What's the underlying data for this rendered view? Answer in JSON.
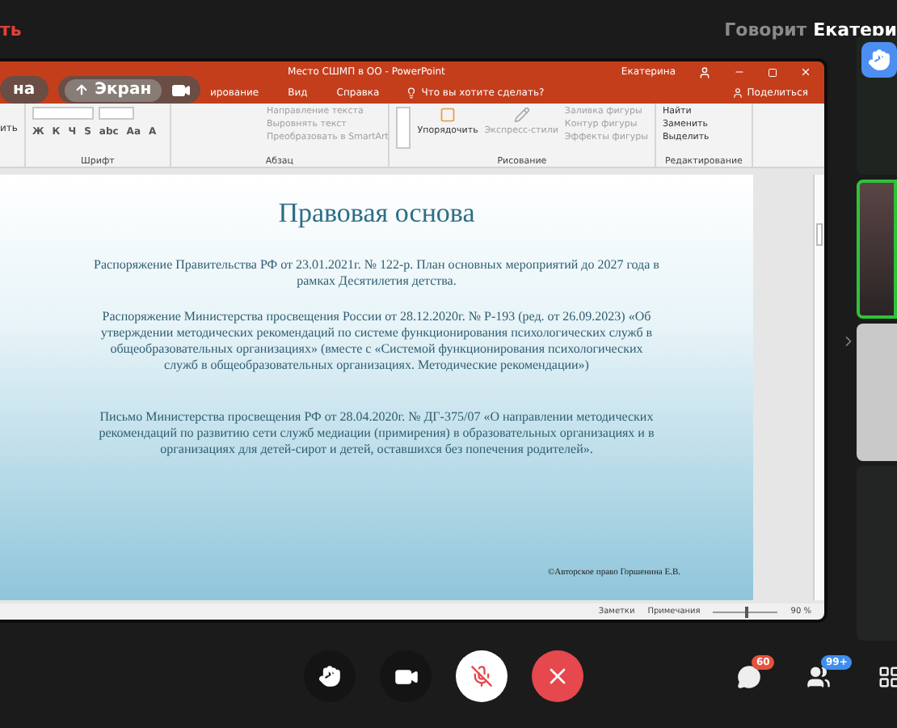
{
  "top_bar": {
    "left_text": "ть",
    "speaker_label": "Говорит",
    "speaker_name": "Екатери"
  },
  "overlay": {
    "window_button": "на",
    "screen_button": "Экран"
  },
  "powerpoint": {
    "title": "Место СШМП в ОО  -  PowerPoint",
    "user": "Екатерина",
    "left_cut": "ить",
    "tabs": [
      {
        "label": "ирование",
        "selected": false
      },
      {
        "label": "Вид",
        "selected": false
      },
      {
        "label": "Справка",
        "selected": false
      }
    ],
    "tell_me": "Что вы хотите сделать?",
    "share": "Поделиться",
    "font_keys": [
      "Ж",
      "К",
      "Ч",
      "S",
      "abc",
      "Aa",
      "A"
    ],
    "groups": [
      {
        "label": "Шрифт"
      },
      {
        "label": "Абзац",
        "commands": [
          {
            "text": "Направление текста",
            "disabled": true
          },
          {
            "text": "Выровнять текст",
            "disabled": true
          },
          {
            "text": "Преобразовать в SmartArt",
            "disabled": true
          }
        ]
      },
      {
        "label": "Рисование",
        "big_buttons": [
          {
            "text": "Упорядочить",
            "disabled": false
          },
          {
            "text": "Экспресс-стили",
            "disabled": true
          }
        ],
        "commands": [
          {
            "text": "Заливка фигуры",
            "disabled": true
          },
          {
            "text": "Контур фигуры",
            "disabled": true
          },
          {
            "text": "Эффекты фигуры",
            "disabled": true
          }
        ]
      },
      {
        "label": "Редактирование",
        "commands": [
          {
            "text": "Найти",
            "disabled": false
          },
          {
            "text": "Заменить",
            "disabled": false
          },
          {
            "text": "Выделить",
            "disabled": false
          }
        ]
      }
    ],
    "slide": {
      "title": "Правовая основа",
      "paragraphs": [
        "Распоряжение Правительства РФ от 23.01.2021г. № 122-р. План основных мероприятий до 2027 года в рамках Десятилетия детства.",
        "Распоряжение Министерства просвещения России от 28.12.2020г. № Р-193 (ред. от 26.09.2023) «Об утверждении методических рекомендаций по системе функционирования психологических служб в общеобразовательных организациях» (вместе с «Системой функционирования психологических служб в общеобразовательных организациях. Методические рекомендации»)",
        "Письмо Министерства просвещения РФ от 28.04.2020г. № ДГ-375/07 «О направлении методических рекомендаций по развитию сети служб медиации (примирения) в образовательных организациях и в организациях для детей-сирот и детей, оставшихся без попечения родителей»."
      ],
      "copyright": "©Авторское право Горшенина Е.В."
    },
    "status_bar": {
      "notes": "Заметки",
      "comments": "Примечания",
      "zoom": "90 %",
      "zoom_slider": {
        "level": 0.5
      }
    }
  },
  "tiles": [
    {
      "kind": "raised-hand",
      "speaking": false
    },
    {
      "kind": "camera",
      "speaking": true
    },
    {
      "kind": "photo",
      "speaking": false
    },
    {
      "kind": "blank",
      "speaking": false
    }
  ],
  "toolbar": {
    "buttons": [
      {
        "kind": "hand"
      },
      {
        "kind": "camera"
      },
      {
        "kind": "mic",
        "muted": true
      },
      {
        "kind": "hangup"
      }
    ],
    "chat_badge": "60",
    "people_badge": "99+"
  }
}
